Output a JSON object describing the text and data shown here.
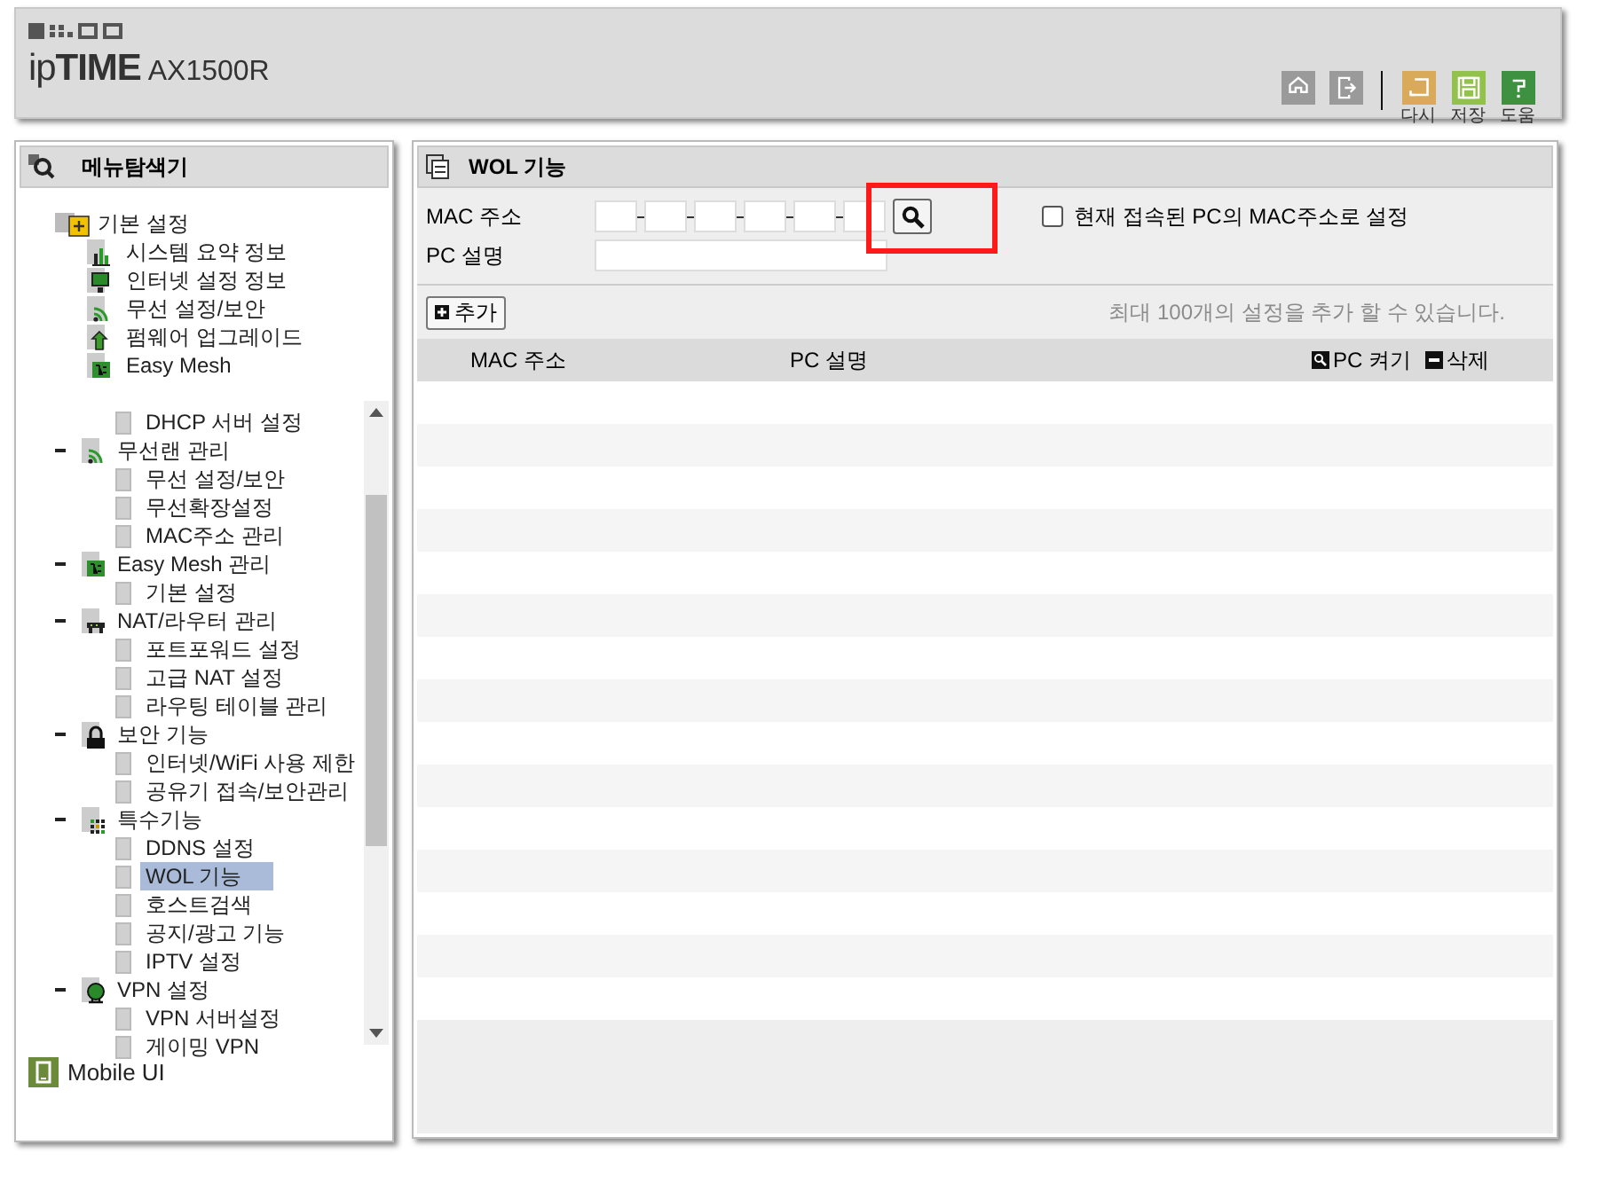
{
  "header": {
    "brand": "ip**TIME**",
    "model": "AX1500R",
    "tools": [
      {
        "kind": "home"
      },
      {
        "kind": "logout"
      },
      {
        "kind": "undo",
        "label": "다시"
      },
      {
        "kind": "save",
        "label": "저장"
      },
      {
        "kind": "help",
        "label": "도움"
      }
    ]
  },
  "sidebar": {
    "title": "메뉴탐색기",
    "quick_menu": {
      "label": "기본 설정",
      "items": [
        {
          "kind": "chart",
          "label": "시스템 요약 정보"
        },
        {
          "kind": "monitor",
          "label": "인터넷 설정 정보"
        },
        {
          "kind": "wifi",
          "label": "무선 설정/보안"
        },
        {
          "kind": "upgrade",
          "label": "펌웨어 업그레이드"
        },
        {
          "kind": "mesh",
          "label": "Easy Mesh"
        }
      ]
    },
    "tree": [
      {
        "children": [
          {
            "label": "DHCP 서버 설정",
            "selected": false
          }
        ]
      },
      {
        "label": "무선랜 관리",
        "kind": "wifi",
        "expanded": true,
        "children": [
          {
            "label": "무선 설정/보안",
            "selected": false
          },
          {
            "label": "무선확장설정",
            "selected": false
          },
          {
            "label": "MAC주소 관리",
            "selected": false
          }
        ]
      },
      {
        "label": "Easy Mesh 관리",
        "kind": "mesh",
        "expanded": true,
        "children": [
          {
            "label": "기본 설정",
            "selected": false
          }
        ]
      },
      {
        "label": "NAT/라우터 관리",
        "kind": "nat",
        "expanded": true,
        "children": [
          {
            "label": "포트포워드 설정",
            "selected": false
          },
          {
            "label": "고급 NAT 설정",
            "selected": false
          },
          {
            "label": "라우팅 테이블 관리",
            "selected": false
          }
        ]
      },
      {
        "label": "보안 기능",
        "kind": "lock",
        "expanded": true,
        "children": [
          {
            "label": "인터넷/WiFi 사용 제한",
            "selected": false
          },
          {
            "label": "공유기 접속/보안관리",
            "selected": false
          }
        ]
      },
      {
        "label": "특수기능",
        "kind": "special",
        "expanded": true,
        "children": [
          {
            "label": "DDNS 설정",
            "selected": false
          },
          {
            "label": "WOL 기능",
            "selected": true
          },
          {
            "label": "호스트검색",
            "selected": false
          },
          {
            "label": "공지/광고 기능",
            "selected": false
          },
          {
            "label": "IPTV 설정",
            "selected": false
          }
        ]
      },
      {
        "label": "VPN 설정",
        "kind": "vpn",
        "expanded": true,
        "children": [
          {
            "label": "VPN 서버설정",
            "selected": false
          },
          {
            "label": "게이밍 VPN",
            "selected": false
          }
        ]
      }
    ],
    "footer": "Mobile UI"
  },
  "main": {
    "title": "WOL 기능",
    "mac_label": "MAC 주소",
    "pc_label": "PC 설명",
    "use_current": {
      "label": "현재 접속된 PC의 MAC주소로 설정",
      "checked": false
    },
    "add_button": "추가",
    "note": "최대 100개의 설정을 추가 할 수 있습니다.",
    "columns": [
      "MAC 주소",
      "PC 설명"
    ],
    "actions": [
      {
        "kind": "wake",
        "label": "PC 켜기"
      },
      {
        "kind": "delete",
        "label": "삭제"
      }
    ]
  }
}
